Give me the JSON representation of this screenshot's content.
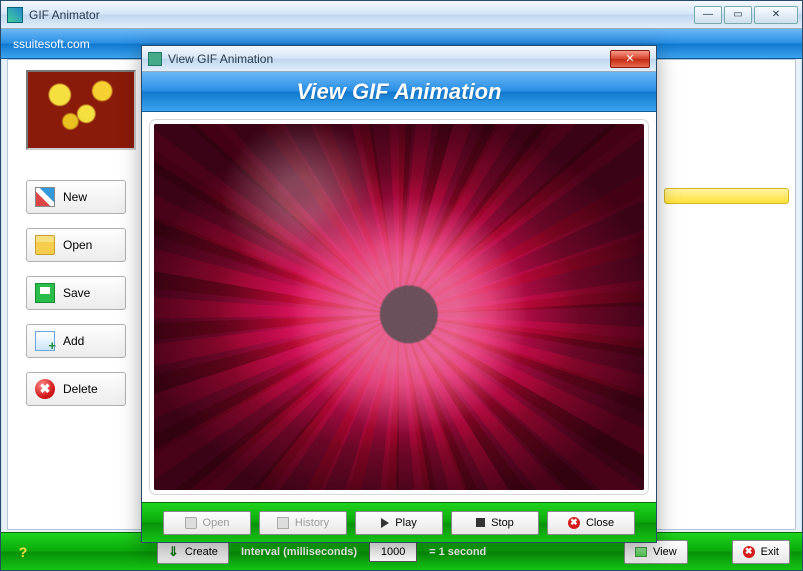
{
  "window": {
    "title": "GIF Animator"
  },
  "header": {
    "site_link": "ssuitesoft.com"
  },
  "side_buttons": {
    "new": "New",
    "open": "Open",
    "save": "Save",
    "add": "Add",
    "delete": "Delete"
  },
  "bottom": {
    "help": "?",
    "create": "Create",
    "interval_label": "Interval (milliseconds)",
    "interval_value": "1000",
    "equals": "= 1 second",
    "view": "View",
    "exit": "Exit"
  },
  "dialog": {
    "titlebar": "View GIF Animation",
    "heading": "View GIF Animation",
    "buttons": {
      "open": "Open",
      "history": "History",
      "play": "Play",
      "stop": "Stop",
      "close": "Close"
    }
  }
}
